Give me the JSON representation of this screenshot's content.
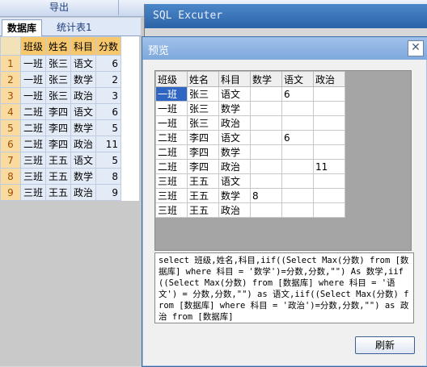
{
  "app": {
    "export_label": "导出",
    "tabs": [
      "数据库",
      "统计表1"
    ],
    "grid_headers": [
      "班级",
      "姓名",
      "科目",
      "分数"
    ],
    "grid_rows": [
      {
        "n": "1",
        "cls": "一班",
        "name": "张三",
        "subj": "语文",
        "score": "6"
      },
      {
        "n": "2",
        "cls": "一班",
        "name": "张三",
        "subj": "数学",
        "score": "2"
      },
      {
        "n": "3",
        "cls": "一班",
        "name": "张三",
        "subj": "政治",
        "score": "3"
      },
      {
        "n": "4",
        "cls": "二班",
        "name": "李四",
        "subj": "语文",
        "score": "6"
      },
      {
        "n": "5",
        "cls": "二班",
        "name": "李四",
        "subj": "数学",
        "score": "5"
      },
      {
        "n": "6",
        "cls": "二班",
        "name": "李四",
        "subj": "政治",
        "score": "11"
      },
      {
        "n": "7",
        "cls": "三班",
        "name": "王五",
        "subj": "语文",
        "score": "5"
      },
      {
        "n": "8",
        "cls": "三班",
        "name": "王五",
        "subj": "数学",
        "score": "8"
      },
      {
        "n": "9",
        "cls": "三班",
        "name": "王五",
        "subj": "政治",
        "score": "9"
      }
    ]
  },
  "sql_window": {
    "title": "SQL Excuter"
  },
  "preview": {
    "title": "预览",
    "close_glyph": "✕",
    "result_headers": [
      "班级",
      "姓名",
      "科目",
      "数学",
      "语文",
      "政治"
    ],
    "result_rows": [
      [
        "一班",
        "张三",
        "语文",
        "",
        "6",
        ""
      ],
      [
        "一班",
        "张三",
        "数学",
        "",
        "",
        ""
      ],
      [
        "一班",
        "张三",
        "政治",
        "",
        "",
        ""
      ],
      [
        "二班",
        "李四",
        "语文",
        "",
        "6",
        ""
      ],
      [
        "二班",
        "李四",
        "数学",
        "",
        "",
        ""
      ],
      [
        "二班",
        "李四",
        "政治",
        "",
        "",
        "11"
      ],
      [
        "三班",
        "王五",
        "语文",
        "",
        "",
        ""
      ],
      [
        "三班",
        "王五",
        "数学",
        "8",
        "",
        ""
      ],
      [
        "三班",
        "王五",
        "政治",
        "",
        "",
        ""
      ]
    ],
    "sql": "select 班级,姓名,科目,iif((Select Max(分数) from [数据库] where 科目 = '数学')=分数,分数,\"\") As 数学,iif((Select Max(分数) from [数据库] where 科目 = '语文') = 分数,分数,\"\") as 语文,iif((Select Max(分数) from [数据库] where 科目 = '政治')=分数,分数,\"\") as 政治 from [数据库]",
    "refresh_label": "刷新"
  },
  "colors": {
    "titlebar": "#2c63a8",
    "preview_titlebar": "#7ea8dc",
    "selected_cell": "#2f66c4",
    "grid_header": "#f6c76b"
  }
}
